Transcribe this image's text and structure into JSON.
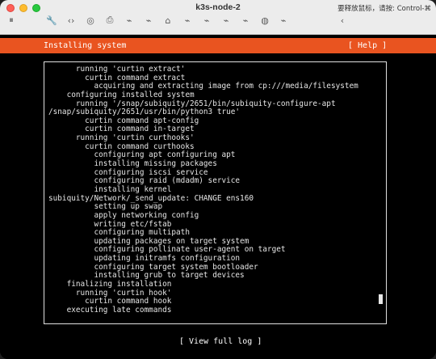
{
  "window": {
    "title": "k3s-node-2",
    "hint": "要释放鼠标，请按: Control-⌘"
  },
  "toolbar": {
    "icons": [
      {
        "name": "pause-icon",
        "glyph": "⏸"
      },
      {
        "name": "wrench-icon",
        "glyph": "🔧"
      },
      {
        "name": "code-icon",
        "glyph": "‹›"
      },
      {
        "name": "disc-icon",
        "glyph": "◎"
      },
      {
        "name": "printer-icon",
        "glyph": "⎙"
      },
      {
        "name": "usb-icon",
        "glyph": "⌁"
      },
      {
        "name": "usb-icon-2",
        "glyph": "⌁"
      },
      {
        "name": "camera-icon",
        "glyph": "⌂"
      },
      {
        "name": "usb-icon-3",
        "glyph": "⌁"
      },
      {
        "name": "usb-icon-4",
        "glyph": "⌁"
      },
      {
        "name": "usb-icon-5",
        "glyph": "⌁"
      },
      {
        "name": "usb-icon-6",
        "glyph": "⌁"
      },
      {
        "name": "fingerprint-icon",
        "glyph": "◍"
      },
      {
        "name": "usb-icon-7",
        "glyph": "⌁"
      },
      {
        "name": "chevron-left-icon",
        "glyph": "‹"
      }
    ]
  },
  "installer": {
    "header_title": "Installing system",
    "help_label": "[ Help ]",
    "view_log_label": "[ View full log ]",
    "scroll_position": 0.93
  },
  "log": {
    "lines": [
      "      running 'curtin extract'",
      "        curtin command extract",
      "          acquiring and extracting image from cp:///media/filesystem",
      "    configuring installed system",
      "      running '/snap/subiquity/2651/bin/subiquity-configure-apt",
      "/snap/subiquity/2651/usr/bin/python3 true'",
      "        curtin command apt-config",
      "        curtin command in-target",
      "      running 'curtin curthooks'",
      "        curtin command curthooks",
      "          configuring apt configuring apt",
      "          installing missing packages",
      "          configuring iscsi service",
      "          configuring raid (mdadm) service",
      "          installing kernel",
      "subiquity/Network/_send_update: CHANGE ens160",
      "          setting up swap",
      "          apply networking config",
      "          writing etc/fstab",
      "          configuring multipath",
      "          updating packages on target system",
      "          configuring pollinate user-agent on target",
      "          updating initramfs configuration",
      "          configuring target system bootloader",
      "          installing grub to target devices",
      "    finalizing installation",
      "      running 'curtin hook'",
      "        curtin command hook",
      "    executing late commands"
    ]
  }
}
